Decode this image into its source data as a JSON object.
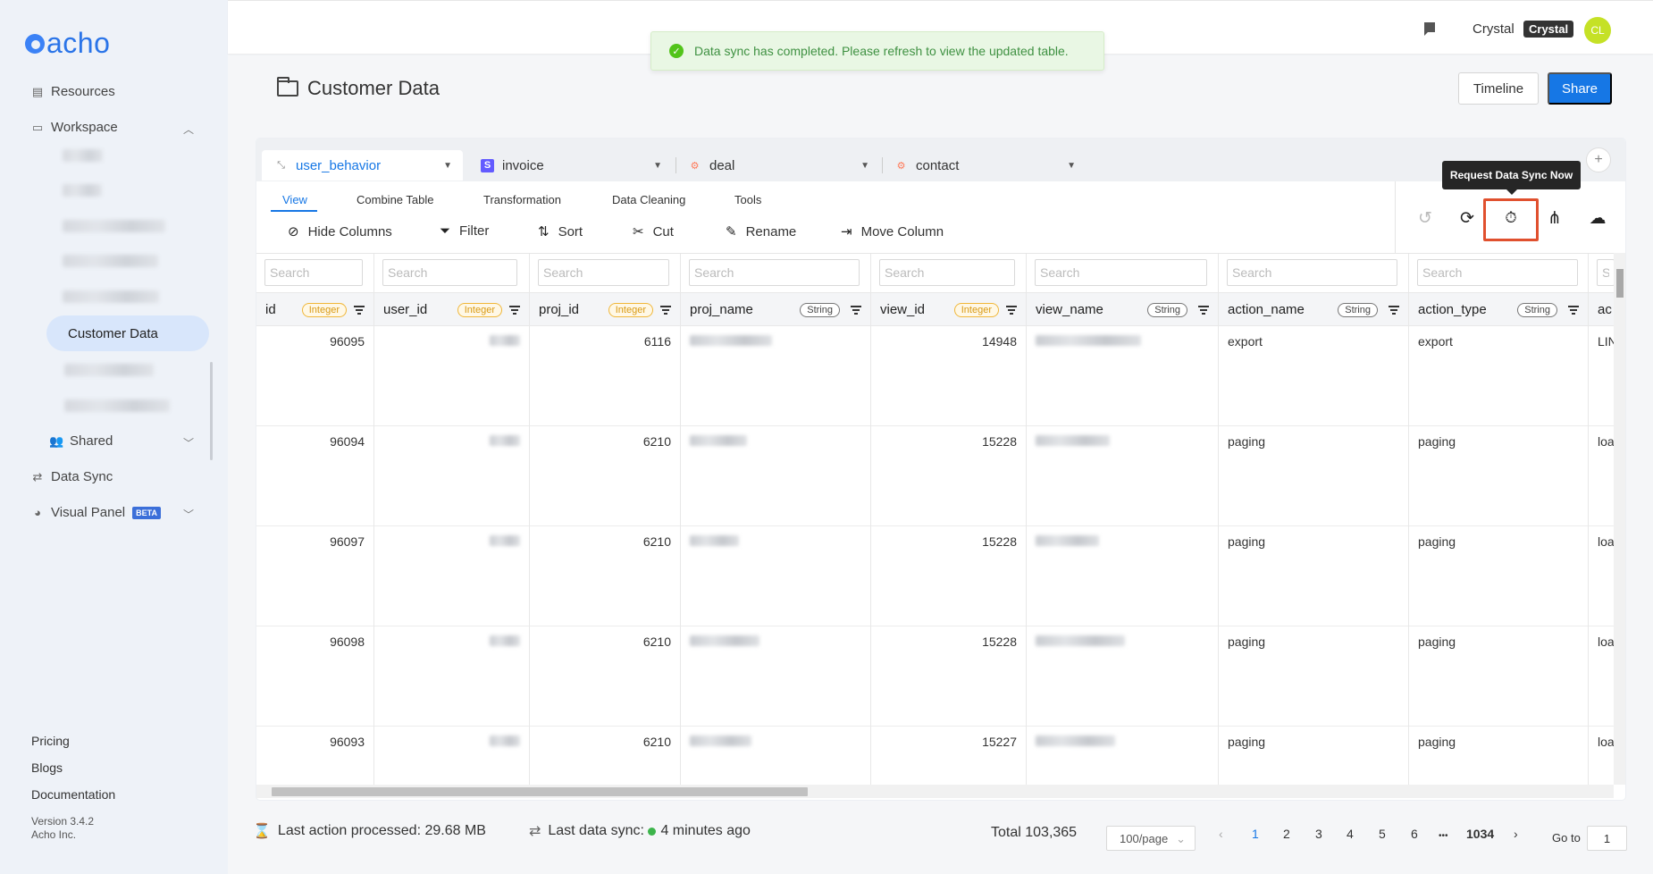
{
  "app": {
    "logo_text": "acho"
  },
  "sidebar": {
    "items": [
      {
        "label": "Resources",
        "icon": "document-icon"
      },
      {
        "label": "Workspace",
        "icon": "workspace-icon"
      },
      {
        "label": "Customer Data"
      },
      {
        "label": "Shared",
        "icon": "users-icon"
      },
      {
        "label": "Data Sync",
        "icon": "sync-arrows-icon"
      },
      {
        "label": "Visual Panel",
        "icon": "pie-chart-icon",
        "badge": "BETA"
      }
    ],
    "footer": [
      "Pricing",
      "Blogs",
      "Documentation"
    ],
    "version": "Version 3.4.2",
    "company": "Acho Inc."
  },
  "header": {
    "user_name": "Crystal",
    "user_badge": "Crystal",
    "avatar_initials": "CL"
  },
  "toast": {
    "message": "Data sync has completed. Please refresh to view the updated table."
  },
  "page": {
    "title": "Customer Data",
    "timeline_label": "Timeline",
    "share_label": "Share"
  },
  "table_tabs": [
    {
      "label": "user_behavior",
      "icon": "table-icon"
    },
    {
      "label": "invoice",
      "icon": "stripe-icon"
    },
    {
      "label": "deal",
      "icon": "hubspot-icon"
    },
    {
      "label": "contact",
      "icon": "hubspot-icon"
    }
  ],
  "subnav": [
    "View",
    "Combine Table",
    "Transformation",
    "Data Cleaning",
    "Tools"
  ],
  "tools": [
    "Hide Columns",
    "Filter",
    "Sort",
    "Cut",
    "Rename",
    "Move Column"
  ],
  "tooltip": "Request Data Sync Now",
  "search_placeholder": "Search",
  "columns": [
    {
      "name": "id",
      "type": "Integer"
    },
    {
      "name": "user_id",
      "type": "Integer"
    },
    {
      "name": "proj_id",
      "type": "Integer"
    },
    {
      "name": "proj_name",
      "type": "String"
    },
    {
      "name": "view_id",
      "type": "Integer"
    },
    {
      "name": "view_name",
      "type": "String"
    },
    {
      "name": "action_name",
      "type": "String"
    },
    {
      "name": "action_type",
      "type": "String"
    },
    {
      "name": "ac"
    }
  ],
  "rows": [
    {
      "id": "96095",
      "proj_id": "6116",
      "view_id": "14948",
      "action_name": "export",
      "action_type": "export",
      "last": "LIN"
    },
    {
      "id": "96094",
      "proj_id": "6210",
      "view_id": "15228",
      "action_name": "paging",
      "action_type": "paging",
      "last": "loa"
    },
    {
      "id": "96097",
      "proj_id": "6210",
      "view_id": "15228",
      "action_name": "paging",
      "action_type": "paging",
      "last": "loa"
    },
    {
      "id": "96098",
      "proj_id": "6210",
      "view_id": "15228",
      "action_name": "paging",
      "action_type": "paging",
      "last": "loa"
    },
    {
      "id": "96093",
      "proj_id": "6210",
      "view_id": "15227",
      "action_name": "paging",
      "action_type": "paging",
      "last": "loa"
    }
  ],
  "footer_bar": {
    "processed_label": "Last action processed:",
    "processed_value": "29.68 MB",
    "sync_label": "Last data sync:",
    "sync_value": "4 minutes ago",
    "total": "Total 103,365",
    "page_size": "100/page",
    "pages": [
      "1",
      "2",
      "3",
      "4",
      "5",
      "6"
    ],
    "ellipsis": "•••",
    "last_page": "1034",
    "goto_label": "Go to",
    "goto_value": "1"
  },
  "colors": {
    "accent": "#1677e5",
    "highlight": "#e0502e",
    "toast_bg": "#e9f7e4"
  }
}
